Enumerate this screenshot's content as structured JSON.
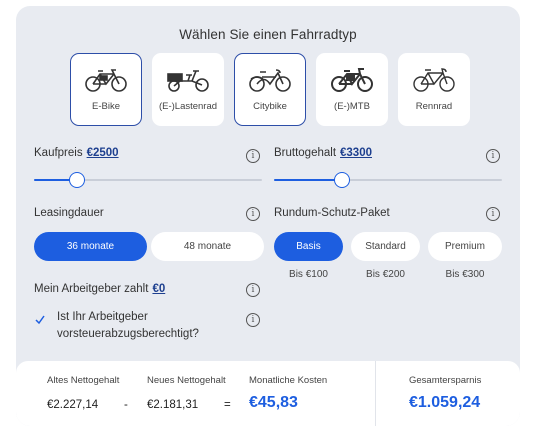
{
  "title": "Wählen Sie einen Fahrradtyp",
  "bike_types": [
    {
      "label": "E-Bike",
      "icon": "ebike-icon",
      "selected": true
    },
    {
      "label": "(E-)Lastenrad",
      "icon": "cargo-bike-icon",
      "selected": false
    },
    {
      "label": "Citybike",
      "icon": "citybike-icon",
      "selected": true
    },
    {
      "label": "(E-)MTB",
      "icon": "mtb-icon",
      "selected": false
    },
    {
      "label": "Rennrad",
      "icon": "road-bike-icon",
      "selected": false
    }
  ],
  "kaufpreis": {
    "label": "Kaufpreis",
    "value": "€2500",
    "slider_fraction": 0.19
  },
  "bruttogehalt": {
    "label": "Bruttogehalt",
    "value": "€3300",
    "slider_fraction": 0.3
  },
  "leasingdauer": {
    "label": "Leasingdauer",
    "options": [
      "36 monate",
      "48 monate"
    ],
    "selected": "36 monate"
  },
  "schutz_paket": {
    "label": "Rundum-Schutz-Paket",
    "options": [
      {
        "label": "Basis",
        "sub": "Bis €100"
      },
      {
        "label": "Standard",
        "sub": "Bis €200"
      },
      {
        "label": "Premium",
        "sub": "Bis €300"
      }
    ],
    "selected": "Basis"
  },
  "arbeitgeber": {
    "label": "Mein Arbeitgeber zahlt",
    "value": "€0"
  },
  "vorsteuer": {
    "line1": "Ist Ihr Arbeitgeber",
    "line2": "vorsteuerabzugsberechtigt?",
    "checked": true
  },
  "info_glyph": "i",
  "summary": {
    "altes_label": "Altes Nettogehalt",
    "altes_value": "€2.227,14",
    "minus": "-",
    "neues_label": "Neues Nettogehalt",
    "neues_value": "€2.181,31",
    "equals": "=",
    "kosten_label": "Monatliche Kosten",
    "kosten_value": "€45,83",
    "ersparnis_label": "Gesamtersparnis",
    "ersparnis_value": "€1.059,24"
  },
  "colors": {
    "accent": "#1d5ee0",
    "link": "#1d3f8f",
    "panel": "#e8ebf1",
    "selected_border": "#2d4ea8"
  }
}
